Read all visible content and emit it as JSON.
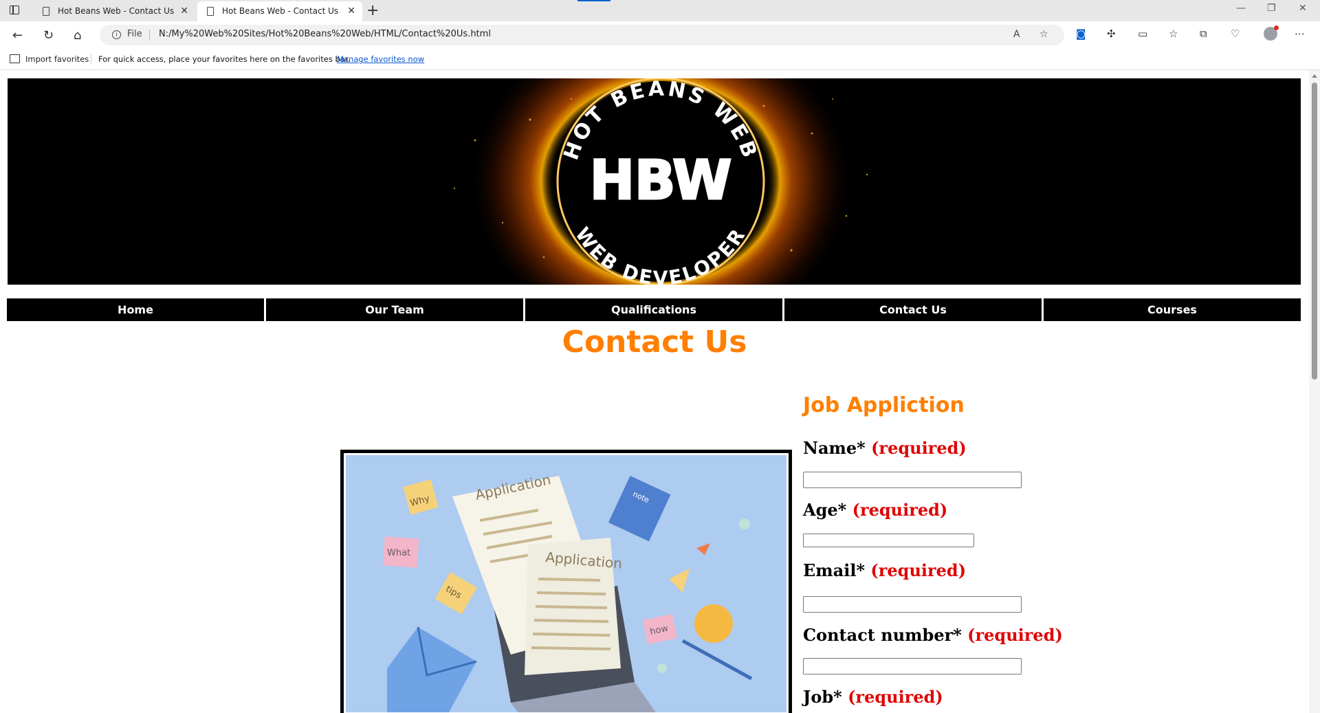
{
  "browser": {
    "tabs": [
      {
        "title": "Hot Beans Web - Contact Us",
        "active": false
      },
      {
        "title": "Hot Beans Web - Contact Us",
        "active": true
      }
    ],
    "address": {
      "scheme_label": "File",
      "url": "N:/My%20Web%20Sites/Hot%20Beans%20Web/HTML/Contact%20Us.html"
    },
    "favorites_bar": {
      "import_label": "Import favorites",
      "message": "For quick access, place your favorites here on the favorites bar.",
      "link": "Manage favorites now"
    }
  },
  "banner": {
    "logo_top_text": "HOT BEANS WEB",
    "logo_center_text": "HBW",
    "logo_bottom_text": "WEB DEVELOPER"
  },
  "nav": {
    "items": [
      "Home",
      "Our Team",
      "Qualifications",
      "Contact Us",
      "Courses"
    ]
  },
  "page": {
    "title": "Contact Us",
    "image_texts": [
      "Application",
      "Application",
      "Why",
      "What",
      "tips",
      "note",
      "how"
    ]
  },
  "form": {
    "heading": "Job Appliction",
    "fields": [
      {
        "label": "Name*",
        "required": "(required)",
        "value": ""
      },
      {
        "label": "Age*",
        "required": "(required)",
        "value": ""
      },
      {
        "label": "Email*",
        "required": "(required)",
        "value": ""
      },
      {
        "label": "Contact number*",
        "required": "(required)",
        "value": ""
      },
      {
        "label": "Job*",
        "required": "(required)",
        "value": ""
      }
    ]
  },
  "colors": {
    "accent": "#ff7f00",
    "required": "#e00000",
    "nav_bg": "#000000",
    "nav_text": "#ffffff"
  }
}
